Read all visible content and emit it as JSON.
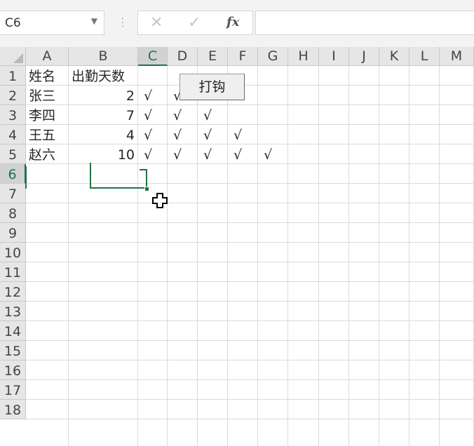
{
  "name_box": {
    "value": "C6"
  },
  "formula_bar": {
    "cancel_glyph": "✕",
    "enter_glyph": "✓",
    "fx_label": "fx",
    "content": ""
  },
  "columns": [
    "A",
    "B",
    "C",
    "D",
    "E",
    "F",
    "G",
    "H",
    "I",
    "J",
    "K",
    "L",
    "M"
  ],
  "rows": [
    "1",
    "2",
    "3",
    "4",
    "5",
    "6",
    "7",
    "8",
    "9",
    "10",
    "11",
    "12",
    "13",
    "14",
    "15",
    "16",
    "17",
    "18"
  ],
  "active_cell": {
    "column": "C",
    "row": "6"
  },
  "cells": {
    "A1": "姓名",
    "B1": "出勤天数",
    "A2": "张三",
    "B2": "2",
    "C2": "√",
    "D2": "√",
    "A3": "李四",
    "B3": "7",
    "C3": "√",
    "D3": "√",
    "E3": "√",
    "A4": "王五",
    "B4": "4",
    "C4": "√",
    "D4": "√",
    "E4": "√",
    "F4": "√",
    "A5": "赵六",
    "B5": "10",
    "C5": "√",
    "D5": "√",
    "E5": "√",
    "F5": "√",
    "G5": "√"
  },
  "sheet_button": {
    "label": "打钩"
  },
  "colors": {
    "accent": "#217346",
    "header_bg": "#e6e6e6",
    "gridline": "#dadada"
  }
}
